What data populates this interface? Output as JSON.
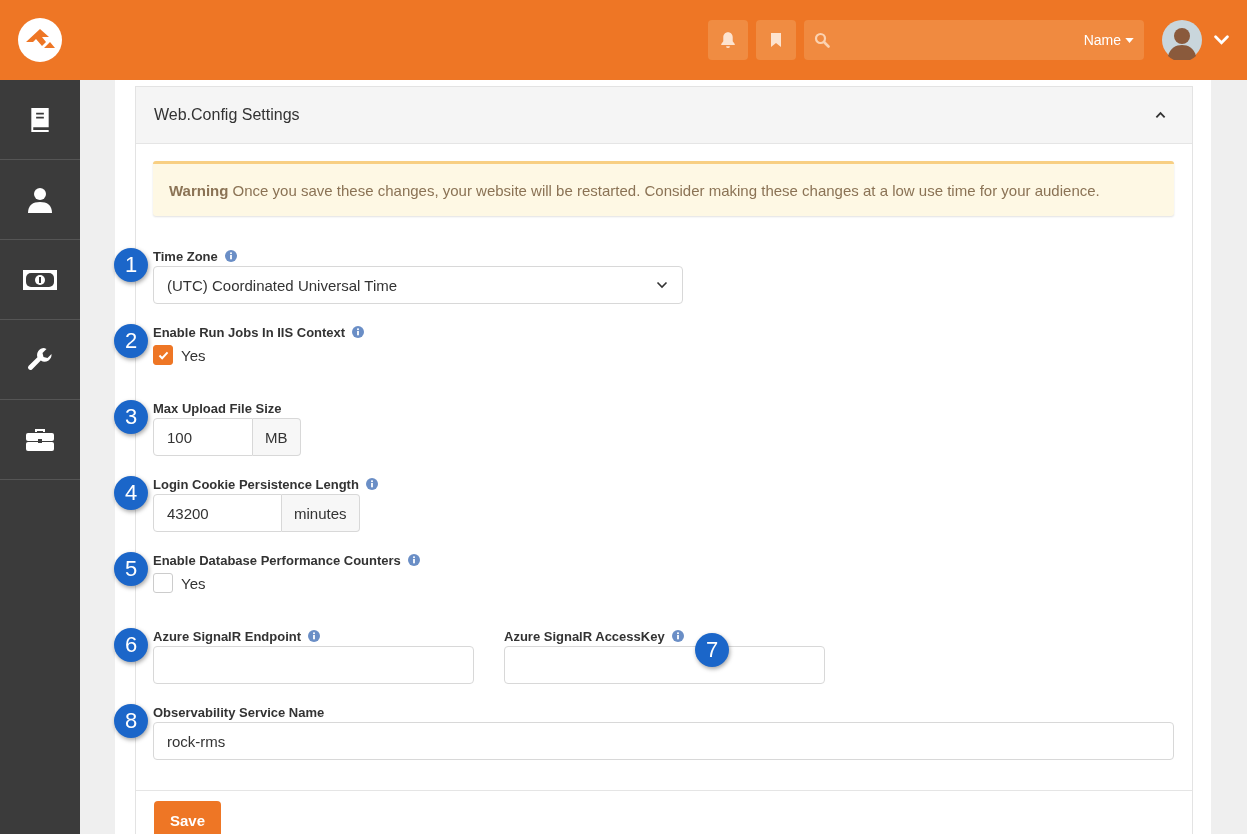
{
  "header": {
    "search_filter": "Name"
  },
  "panel": {
    "title": "Web.Config Settings",
    "expanded": true
  },
  "alert": {
    "text": "**Warning** Once you save these changes, your website will be restarted. Consider making these changes at a low use time for your audience."
  },
  "rows": [
    [
      {
        "kind": "select",
        "label": "Time Zone",
        "help": true,
        "marker": "1",
        "value": "(UTC) Coordinated Universal Time"
      }
    ],
    [
      {
        "kind": "checkbox",
        "label": "Enable Run Jobs In IIS Context",
        "help": true,
        "marker": "2",
        "option": "Yes",
        "checked": true
      }
    ],
    [
      {
        "kind": "addon",
        "label": "Max Upload File Size",
        "help": false,
        "marker": "3",
        "value": "100",
        "unit": "MB"
      }
    ],
    [
      {
        "kind": "addon",
        "label": "Login Cookie Persistence Length",
        "help": true,
        "marker": "4",
        "value": "43200",
        "unit": "minutes"
      }
    ],
    [
      {
        "kind": "checkbox",
        "label": "Enable Database Performance Counters",
        "help": true,
        "marker": "5",
        "option": "Yes",
        "checked": false
      }
    ],
    [
      {
        "kind": "text",
        "label": "Azure SignalR Endpoint",
        "help": true,
        "marker": "6"
      },
      {
        "kind": "text",
        "label": "Azure SignalR AccessKey",
        "help": true,
        "marker": "7"
      }
    ],
    [
      {
        "kind": "wide",
        "label": "Observability Service Name",
        "help": false,
        "marker": "8",
        "value": "rock-rms"
      }
    ]
  ],
  "save_button": "Save"
}
